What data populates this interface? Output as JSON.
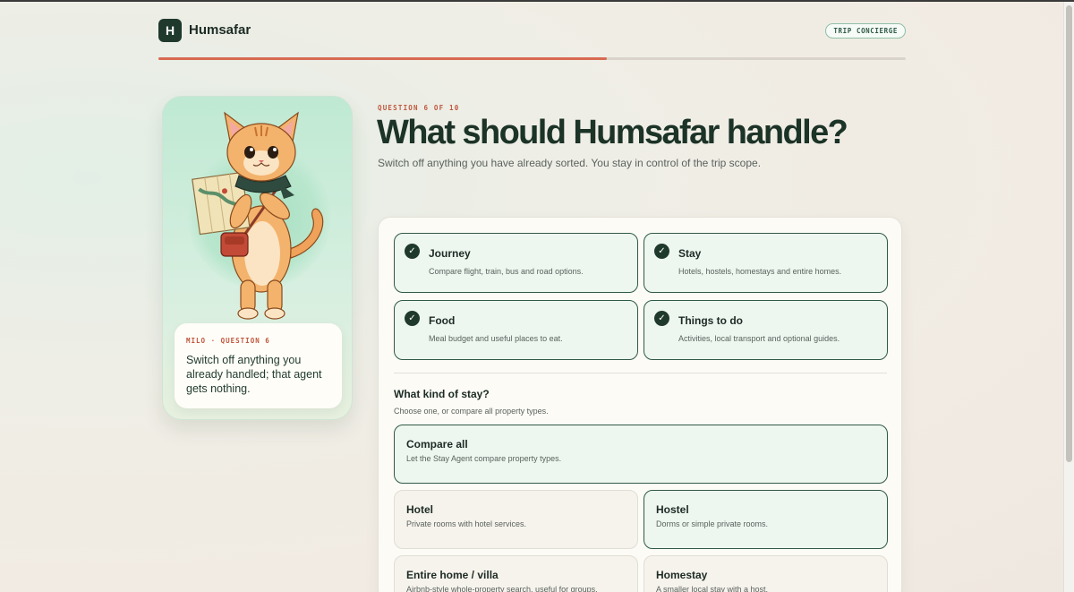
{
  "app": {
    "logo_letter": "H",
    "name": "Humsafar",
    "badge": "TRIP CONCIERGE"
  },
  "progress": {
    "fraction": 0.6
  },
  "milo": {
    "tag": "MILO · QUESTION 6",
    "message": "Switch off anything you already handled; that agent gets nothing."
  },
  "question": {
    "number_label": "QUESTION 6 OF 10",
    "title": "What should Humsafar handle?",
    "subtitle": "Switch off anything you have already sorted. You stay in control of the trip scope."
  },
  "services": [
    {
      "title": "Journey",
      "desc": "Compare flight, train, bus and road options.",
      "checked": true
    },
    {
      "title": "Stay",
      "desc": "Hotels, hostels, homestays and entire homes.",
      "checked": true
    },
    {
      "title": "Food",
      "desc": "Meal budget and useful places to eat.",
      "checked": true
    },
    {
      "title": "Things to do",
      "desc": "Activities, local transport and optional guides.",
      "checked": true
    }
  ],
  "stay_kind": {
    "title": "What kind of stay?",
    "subtitle": "Choose one, or compare all property types.",
    "options": [
      {
        "title": "Compare all",
        "desc": "Let the Stay Agent compare property types.",
        "selected": true
      },
      {
        "title": "Hotel",
        "desc": "Private rooms with hotel services.",
        "selected": false
      },
      {
        "title": "Hostel",
        "desc": "Dorms or simple private rooms.",
        "selected": true
      },
      {
        "title": "Entire home / villa",
        "desc": "Airbnb-style whole-property search, useful for groups.",
        "selected": false
      },
      {
        "title": "Homestay",
        "desc": "A smaller local stay with a host.",
        "selected": false
      }
    ]
  },
  "icons": {
    "check": "check-icon",
    "mascot": "cat-mascot-illustration"
  },
  "colors": {
    "primary": "#1f3a2d",
    "accent": "#d86a52",
    "selected_bg": "#eef6f0"
  }
}
